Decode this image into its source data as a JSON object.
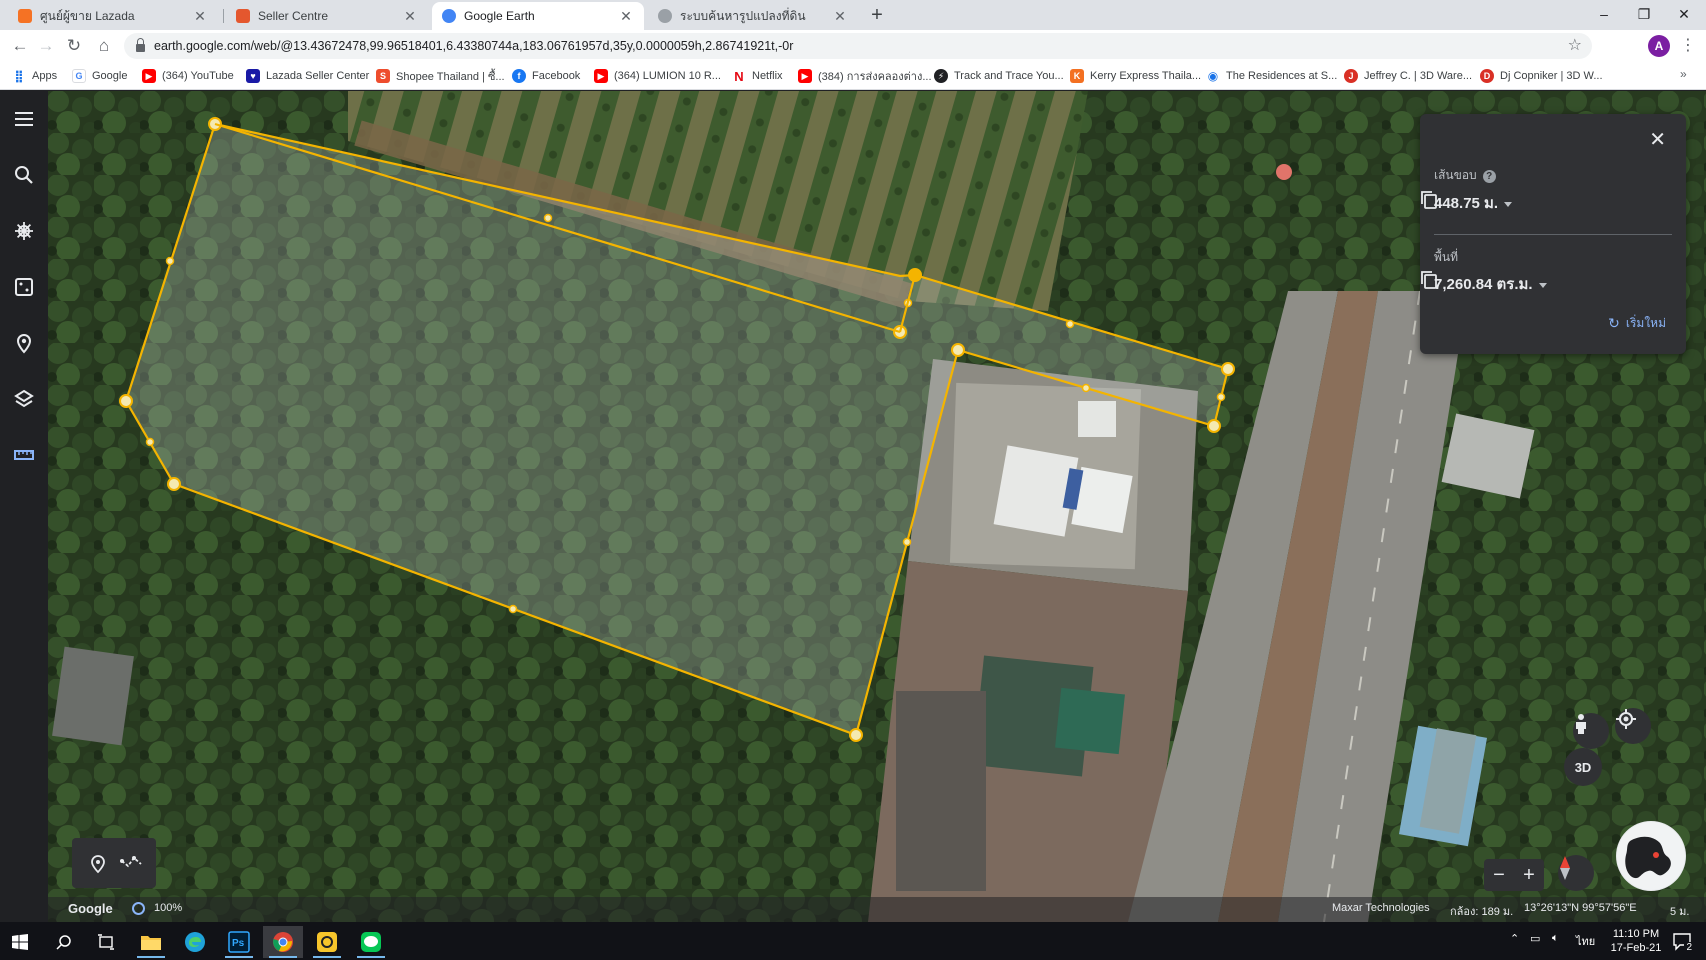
{
  "browser": {
    "tabs": [
      {
        "title": "ศูนย์ผู้ขาย Lazada",
        "favicon_color": "#f57224",
        "active": false
      },
      {
        "title": "Seller Centre",
        "favicon_color": "#e4572e",
        "active": false
      },
      {
        "title": "Google Earth",
        "favicon_color": "#4285f4",
        "active": true
      },
      {
        "title": "ระบบค้นหารูปแปลงที่ดิน",
        "favicon_color": "#9aa0a6",
        "active": false
      }
    ],
    "url": "earth.google.com/web/@13.43672478,99.96518401,6.43380744a,183.06761957d,35y,0.0000059h,2.86741921t,-0r",
    "profile_initial": "A",
    "bookmarks": [
      {
        "label": "Apps",
        "icon": "apps-grid-icon",
        "color": "#4285f4"
      },
      {
        "label": "Google",
        "icon": "google-icon",
        "color": "#4285f4"
      },
      {
        "label": "(364) YouTube",
        "icon": "youtube-icon",
        "color": "#ff0000"
      },
      {
        "label": "Lazada Seller Center",
        "icon": "lazada-icon",
        "color": "#1a1aa6"
      },
      {
        "label": "Shopee Thailand | ซื้...",
        "icon": "shopee-icon",
        "color": "#ee4d2d"
      },
      {
        "label": "Facebook",
        "icon": "facebook-icon",
        "color": "#1877f2"
      },
      {
        "label": "(364) LUMION 10 R...",
        "icon": "youtube-icon",
        "color": "#ff0000"
      },
      {
        "label": "Netflix",
        "icon": "netflix-icon",
        "color": "#e50914"
      },
      {
        "label": "(384) การส่งคลองต่าง...",
        "icon": "youtube-icon",
        "color": "#ff0000"
      },
      {
        "label": "Track and Trace You...",
        "icon": "track-icon",
        "color": "#202124"
      },
      {
        "label": "Kerry Express Thaila...",
        "icon": "kerry-icon",
        "color": "#f37021"
      },
      {
        "label": "The Residences at S...",
        "icon": "location-icon",
        "color": "#1a73e8"
      },
      {
        "label": "Jeffrey C. | 3D Ware...",
        "icon": "jeffrey-icon",
        "color": "#d93025"
      },
      {
        "label": "Dj Copniker | 3D W...",
        "icon": "dj-icon",
        "color": "#d93025"
      }
    ]
  },
  "measure": {
    "perimeter_label": "เส้นขอบ",
    "perimeter_value": "448.75 ม.",
    "area_label": "พื้นที่",
    "area_value": "7,260.84 ตร.ม.",
    "restart_label": "เริ่มใหม่",
    "accent_color": "#f4b400"
  },
  "footer": {
    "brand": "Google",
    "zoom": "100%",
    "attribution": "Maxar Technologies",
    "camera": "กล้อง: 189 ม.",
    "coords": "13°26'13\"N 99°57'56\"E",
    "scale": "5 ม."
  },
  "map_controls": {
    "three_d": "3D"
  },
  "taskbar": {
    "time": "11:10 PM",
    "date": "17-Feb-21",
    "lang": "ไทย",
    "notifications": "2"
  }
}
